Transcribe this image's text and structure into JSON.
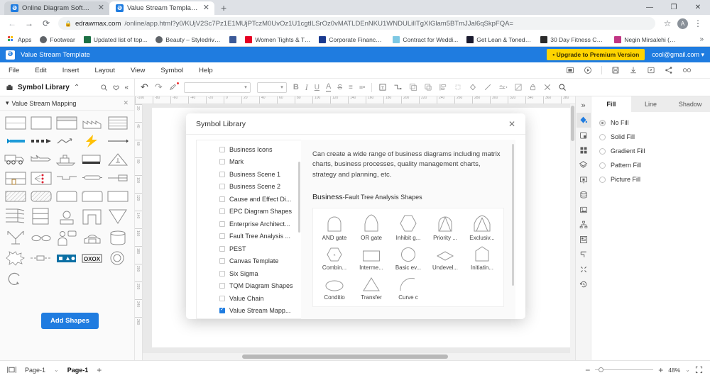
{
  "browser": {
    "tabs": [
      {
        "title": "Online Diagram Software - Edraw",
        "active": false
      },
      {
        "title": "Value Stream Template - Edraw M",
        "active": true
      }
    ],
    "new_tab_label": "+",
    "close_label": "✕",
    "window_controls": {
      "minimize": "—",
      "maximize": "❐",
      "close": "✕"
    },
    "nav": {
      "back": "←",
      "forward": "→",
      "reload": "⟳"
    },
    "url_domain": "edrawmax.com",
    "url_rest": "/online/app.html?y0/KUjV2Sc7Pz1E1MUjPTczM0UvOz1U1cgtILSrOz0vMATLDEnNKU1WNDULilITgXIGlam5BTmJJal6qSkpFQA=",
    "star_icon": "☆",
    "profile_initial": "A",
    "menu_icon": "⋮",
    "bookmarks": [
      {
        "label": "Apps",
        "icon": "grid"
      },
      {
        "label": "Footwear",
        "icon": "dot",
        "color": "#5f6368"
      },
      {
        "label": "Updated list of top...",
        "icon": "sq",
        "color": "#1d7044"
      },
      {
        "label": "Beauty – Styledrive...",
        "icon": "dot",
        "color": "#5f6368"
      },
      {
        "label": "",
        "icon": "sq",
        "color": "#3b5998"
      },
      {
        "label": "Women Tights & Tr...",
        "icon": "sq",
        "color": "#e60023"
      },
      {
        "label": "Corporate Finance J...",
        "icon": "sq",
        "color": "#1a3a8f"
      },
      {
        "label": "Contract for Weddi...",
        "icon": "sq",
        "color": "#7ec8e3"
      },
      {
        "label": "Get Lean & Toned i...",
        "icon": "sq",
        "color": "#1a1a2e"
      },
      {
        "label": "30 Day Fitness Chal...",
        "icon": "sq",
        "color": "#2b2b2b"
      },
      {
        "label": "Negin Mirsalehi (@...",
        "icon": "sq",
        "color": "#c13584"
      }
    ],
    "bookmarks_overflow": "»"
  },
  "app_header": {
    "logo_letter": "Ə",
    "title": "Value Stream Template",
    "upgrade_label": "• Upgrade to Premium Version",
    "account": "cool@gmail.com",
    "account_caret": "▾"
  },
  "menubar": {
    "items": [
      "File",
      "Edit",
      "Insert",
      "Layout",
      "View",
      "Symbol",
      "Help"
    ],
    "right_icons": [
      "present-icon",
      "play-icon",
      "save-icon",
      "download-icon",
      "export-icon",
      "share-icon",
      "collaborate-icon"
    ]
  },
  "toolbar": {
    "symbol_library_label": "Symbol Library",
    "collapse_caret": "⌃",
    "search_icon": "search-icon",
    "favorite_icon": "heart-icon",
    "collapse_icon": "«",
    "undo": "↶",
    "redo": "↷",
    "format_painter": "format-painter-icon",
    "font_family_value": "",
    "font_size_value": "",
    "bold": "B",
    "italic": "I",
    "underline": "U",
    "font_color": "A",
    "strikethrough": "S",
    "clear_format": "T",
    "align": "≡",
    "line_spacing": "≛",
    "text_box": "T",
    "connector": "connector-icon",
    "group": "group-icon",
    "duplicate": "duplicate-icon",
    "align_objects": "align-icon",
    "crop": "crop-icon",
    "fill": "fill-icon",
    "line": "line-icon",
    "arrows": "arrow-style-icon",
    "shape_format": "shape-format-icon",
    "lock": "lock-icon",
    "tools": "tools-icon",
    "search": "search-icon"
  },
  "left_panel": {
    "category_label": "Value Stream Mapping",
    "category_caret": "▾",
    "close_icon": "✕",
    "add_shapes_label": "Add Shapes"
  },
  "ruler": {
    "h_ticks": [
      "-100",
      "-80",
      "-60",
      "-40",
      "-20",
      "0",
      "20",
      "40",
      "60",
      "80",
      "100",
      "120",
      "140",
      "160",
      "180",
      "200",
      "220",
      "240",
      "260",
      "280",
      "300",
      "320",
      "340",
      "360",
      "380",
      "400"
    ],
    "v_ticks": [
      "20",
      "40",
      "60",
      "80",
      "100",
      "120",
      "140",
      "160",
      "180",
      "200",
      "220",
      "240",
      "260"
    ]
  },
  "right_strip": {
    "expand": "»",
    "icons": [
      "fill-icon",
      "shape-properties-icon",
      "symbols-icon",
      "layers-icon",
      "presentation-icon",
      "data-icon",
      "image-icon",
      "org-chart-icon",
      "floor-plan-icon",
      "align-tools-icon",
      "fullscreen-icon",
      "history-icon"
    ]
  },
  "right_panel": {
    "tabs": [
      {
        "label": "Fill",
        "active": true
      },
      {
        "label": "Line",
        "active": false
      },
      {
        "label": "Shadow",
        "active": false
      }
    ],
    "fill_options": [
      {
        "label": "No Fill",
        "selected": true
      },
      {
        "label": "Solid Fill",
        "selected": false
      },
      {
        "label": "Gradient Fill",
        "selected": false
      },
      {
        "label": "Pattern Fill",
        "selected": false
      },
      {
        "label": "Picture Fill",
        "selected": false
      }
    ]
  },
  "status_bar": {
    "page_view_icon": "page-view-icon",
    "page_select_value": "Page-1",
    "page_select_caret": "⌄",
    "active_tab_label": "Page-1",
    "add_page_label": "+",
    "zoom_out": "−",
    "zoom_in": "+",
    "zoom_value": "48%",
    "zoom_caret": "⌄",
    "fit_icon": "fit-screen-icon"
  },
  "modal": {
    "title": "Symbol Library",
    "close_icon": "✕",
    "categories": [
      {
        "label": "Business Icons",
        "checked": false
      },
      {
        "label": "Mark",
        "checked": false
      },
      {
        "label": "Business Scene 1",
        "checked": false
      },
      {
        "label": "Business Scene 2",
        "checked": false
      },
      {
        "label": "Cause and Effect Di...",
        "checked": false
      },
      {
        "label": "EPC Diagram Shapes",
        "checked": false
      },
      {
        "label": "Enterprise Architect...",
        "checked": false
      },
      {
        "label": "Fault Tree Analysis ...",
        "checked": false
      },
      {
        "label": "PEST",
        "checked": false
      },
      {
        "label": "Canvas Template",
        "checked": false
      },
      {
        "label": "Six Sigma",
        "checked": false
      },
      {
        "label": "TQM Diagram Shapes",
        "checked": false
      },
      {
        "label": "Value Chain",
        "checked": false
      },
      {
        "label": "Value Stream Mapp...",
        "checked": true
      }
    ],
    "description": "Can create a wide range of business diagrams including matrix charts, business processes, quality management charts, strategy and planning, etc.",
    "section_prefix": "Business",
    "section_suffix": "-Fault Tree Analysis Shapes",
    "shapes": [
      {
        "name": "AND gate",
        "glyph": "and-gate"
      },
      {
        "name": "OR gate",
        "glyph": "or-gate"
      },
      {
        "name": "Inhibit g...",
        "glyph": "hexagon"
      },
      {
        "name": "Priority ...",
        "glyph": "priority-and"
      },
      {
        "name": "Exclusiv...",
        "glyph": "exclusive-or"
      },
      {
        "name": "Combin...",
        "glyph": "hexagon-small"
      },
      {
        "name": "Interme...",
        "glyph": "rect"
      },
      {
        "name": "Basic ev...",
        "glyph": "circle"
      },
      {
        "name": "Undevel...",
        "glyph": "diamond"
      },
      {
        "name": "Initiatin...",
        "glyph": "home"
      },
      {
        "name": "Conditio",
        "glyph": "ellipse"
      },
      {
        "name": "Transfer",
        "glyph": "triangle"
      },
      {
        "name": "Curve c",
        "glyph": "arc"
      }
    ]
  }
}
